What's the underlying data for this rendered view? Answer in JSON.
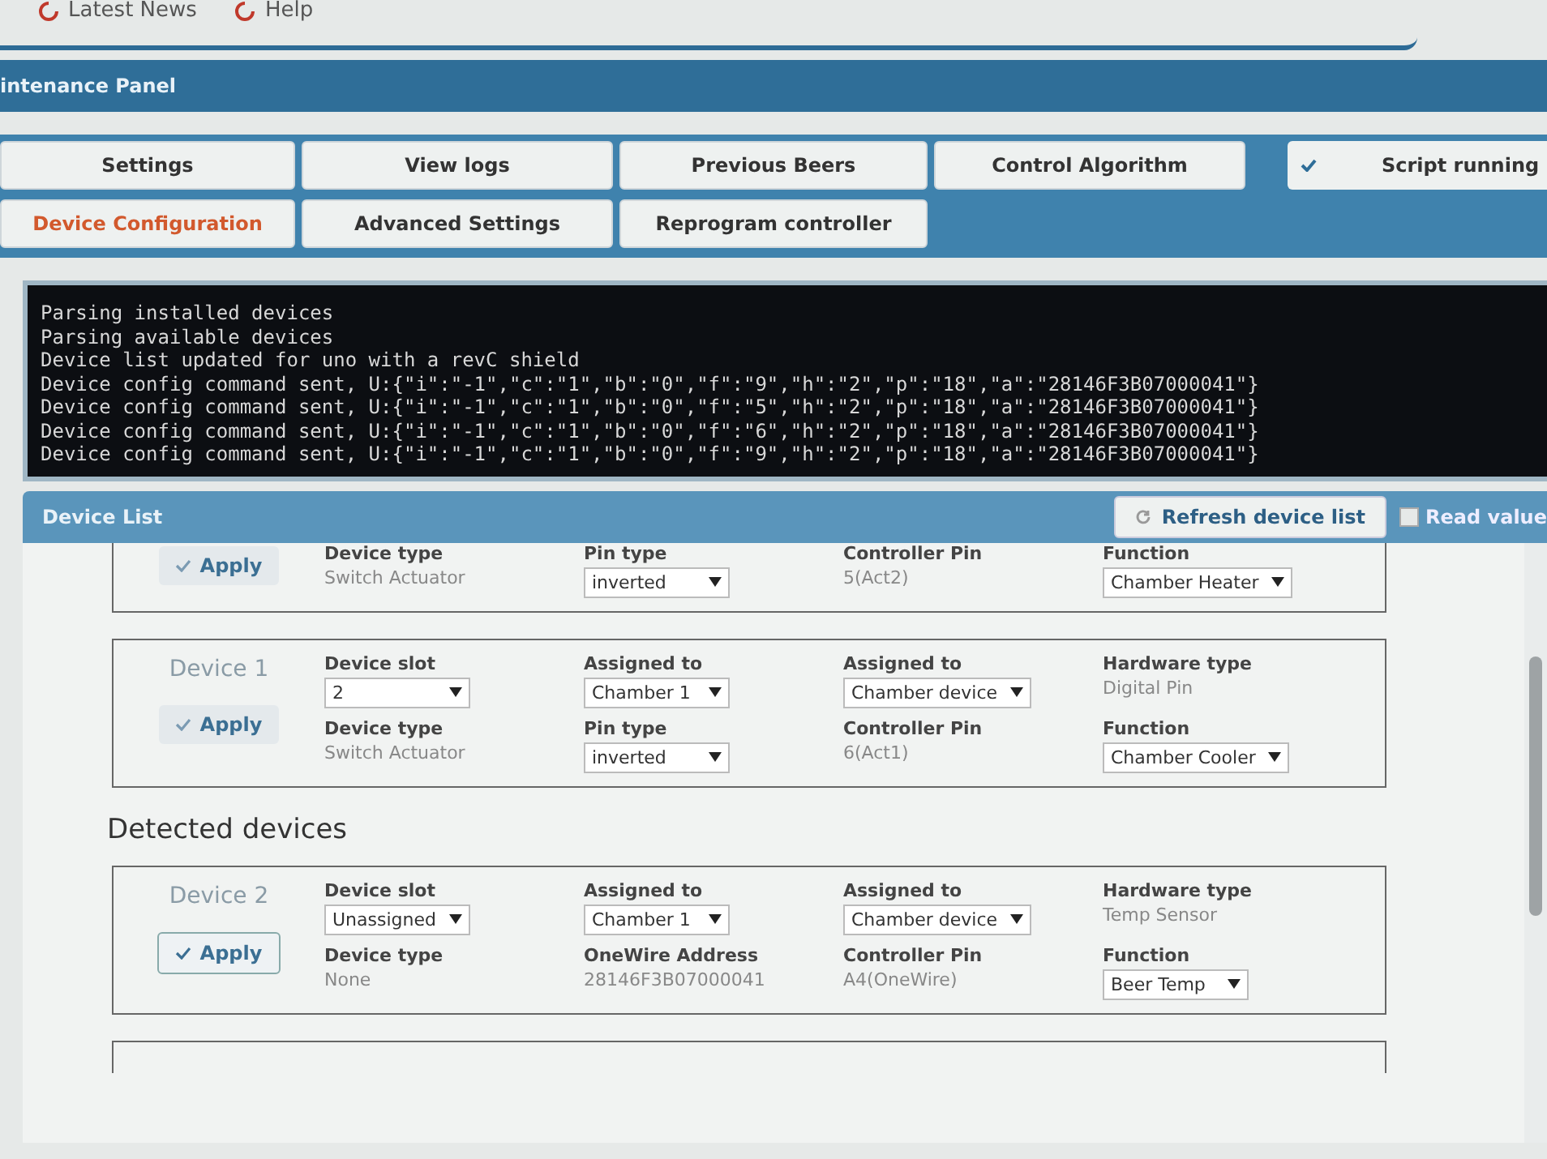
{
  "top_links": [
    {
      "label": "Latest News"
    },
    {
      "label": "Help"
    }
  ],
  "panel_title": "intenance Panel",
  "tabs": [
    {
      "label": "Settings",
      "selected": false
    },
    {
      "label": "View logs",
      "selected": false
    },
    {
      "label": "Previous Beers",
      "selected": false
    },
    {
      "label": "Control Algorithm",
      "selected": false
    },
    {
      "label": "Device Configuration",
      "selected": true
    },
    {
      "label": "Advanced Settings",
      "selected": false
    },
    {
      "label": "Reprogram controller",
      "selected": false
    }
  ],
  "script_status": {
    "label": "Script running",
    "on": true
  },
  "console": [
    "Parsing installed devices",
    "Parsing available devices",
    "Device list updated for uno with a revC shield",
    "Device config command sent, U:{\"i\":\"-1\",\"c\":\"1\",\"b\":\"0\",\"f\":\"9\",\"h\":\"2\",\"p\":\"18\",\"a\":\"28146F3B07000041\"}",
    "Device config command sent, U:{\"i\":\"-1\",\"c\":\"1\",\"b\":\"0\",\"f\":\"5\",\"h\":\"2\",\"p\":\"18\",\"a\":\"28146F3B07000041\"}",
    "Device config command sent, U:{\"i\":\"-1\",\"c\":\"1\",\"b\":\"0\",\"f\":\"6\",\"h\":\"2\",\"p\":\"18\",\"a\":\"28146F3B07000041\"}",
    "Device config command sent, U:{\"i\":\"-1\",\"c\":\"1\",\"b\":\"0\",\"f\":\"9\",\"h\":\"2\",\"p\":\"18\",\"a\":\"28146F3B07000041\"}"
  ],
  "device_list": {
    "title": "Device List",
    "refresh": "Refresh device list",
    "read_values": {
      "label": "Read value",
      "checked": false
    }
  },
  "installed_devices": [
    {
      "apply": "Apply",
      "fields": [
        {
          "label": "Device type",
          "kind": "text",
          "value": "Switch Actuator"
        },
        {
          "label": "Pin type",
          "kind": "select",
          "value": "inverted"
        },
        {
          "label": "Controller Pin",
          "kind": "text",
          "value": "5(Act2)"
        },
        {
          "label": "Function",
          "kind": "select",
          "value": "Chamber Heater"
        }
      ]
    },
    {
      "name": "Device 1",
      "apply": "Apply",
      "fields": [
        {
          "label": "Device slot",
          "kind": "select",
          "value": "2"
        },
        {
          "label": "Assigned to",
          "kind": "select",
          "value": "Chamber 1"
        },
        {
          "label": "Assigned to",
          "kind": "select",
          "value": "Chamber device"
        },
        {
          "label": "Hardware type",
          "kind": "text",
          "value": "Digital Pin"
        },
        {
          "label": "Device type",
          "kind": "text",
          "value": "Switch Actuator"
        },
        {
          "label": "Pin type",
          "kind": "select",
          "value": "inverted"
        },
        {
          "label": "Controller Pin",
          "kind": "text",
          "value": "6(Act1)"
        },
        {
          "label": "Function",
          "kind": "select",
          "value": "Chamber Cooler"
        }
      ]
    }
  ],
  "detected_title": "Detected devices",
  "detected_devices": [
    {
      "name": "Device 2",
      "apply": "Apply",
      "fields": [
        {
          "label": "Device slot",
          "kind": "select",
          "value": "Unassigned"
        },
        {
          "label": "Assigned to",
          "kind": "select",
          "value": "Chamber 1"
        },
        {
          "label": "Assigned to",
          "kind": "select",
          "value": "Chamber device"
        },
        {
          "label": "Hardware type",
          "kind": "text",
          "value": "Temp Sensor"
        },
        {
          "label": "Device type",
          "kind": "text",
          "value": "None"
        },
        {
          "label": "OneWire Address",
          "kind": "text",
          "value": "28146F3B07000041"
        },
        {
          "label": "Controller Pin",
          "kind": "text",
          "value": "A4(OneWire)"
        },
        {
          "label": "Function",
          "kind": "select",
          "value": "Beer Temp"
        }
      ]
    }
  ]
}
